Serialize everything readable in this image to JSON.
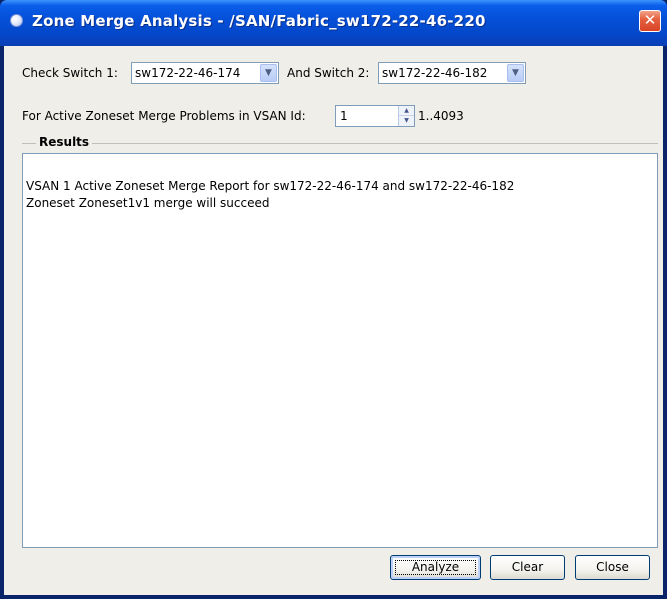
{
  "window": {
    "title": "Zone Merge Analysis - /SAN/Fabric_sw172-22-46-220",
    "close_icon": "close-icon"
  },
  "form": {
    "switch1_label": "Check Switch 1:",
    "switch1_value": "sw172-22-46-174",
    "switch2_label": "And Switch 2:",
    "switch2_value": "sw172-22-46-182",
    "vsan_label": "For Active Zoneset Merge Problems in VSAN Id:",
    "vsan_value": "1",
    "vsan_range": "1..4093"
  },
  "results": {
    "group_title": "Results",
    "lines": [
      "VSAN 1 Active Zoneset Merge Report for sw172-22-46-174 and sw172-22-46-182",
      "Zoneset Zoneset1v1 merge will succeed"
    ]
  },
  "buttons": {
    "analyze": "Analyze",
    "clear": "Clear",
    "close": "Close"
  }
}
